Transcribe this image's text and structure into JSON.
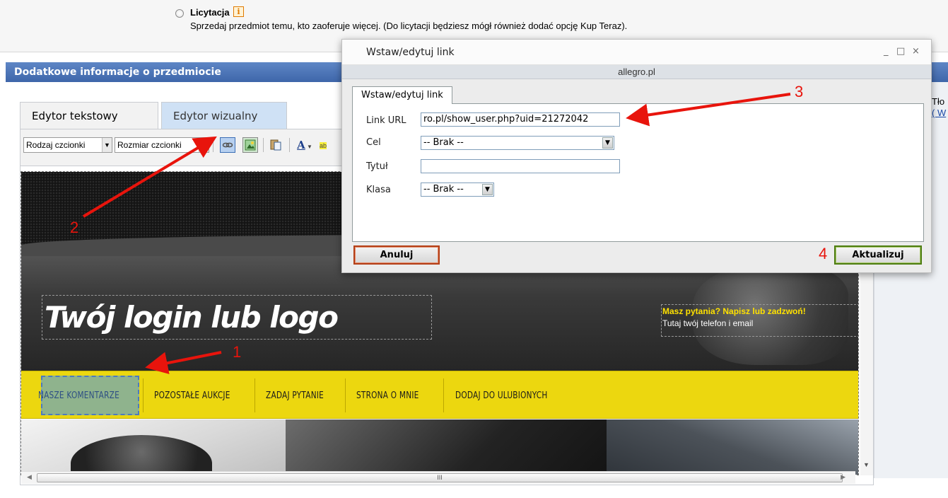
{
  "auction": {
    "title": "Licytacja",
    "info_icon_glyph": "i",
    "description": "Sprzedaj przedmiot temu, kto zaoferuje więcej. (Do licytacji będziesz mógł również dodać opcję Kup Teraz)."
  },
  "section": {
    "title": "Dodatkowe informacje o przedmiocie"
  },
  "right_panel": {
    "text": "Tło",
    "link": "( W"
  },
  "editor": {
    "tabs": [
      {
        "label": "Edytor tekstowy",
        "active": true
      },
      {
        "label": "Edytor wizualny",
        "active": false
      }
    ],
    "toolbar": {
      "font_family_select": "Rodzaj czcionki",
      "font_size_select": "Rozmiar czcionki",
      "icons": [
        "link-icon",
        "image-icon",
        "paste-icon",
        "font-color-icon",
        "highlight-icon"
      ]
    },
    "content": {
      "logo_text": "Twój login lub logo",
      "contact_question": "Masz pytania? Napisz lub zadzwoń!",
      "contact_text": "Tutaj twój telefon i email",
      "nav_items": [
        "NASZE KOMENTARZE",
        "POZOSTAŁE AUKCJE",
        "ZADAJ PYTANIE",
        "STRONA O MNIE",
        "DODAJ DO ULUBIONYCH"
      ]
    },
    "scrollbar_thumb_label": "III"
  },
  "dialog": {
    "title": "Wstaw/edytuj link",
    "domain": "allegro.pl",
    "tab": "Wstaw/edytuj link",
    "fields": {
      "url_label": "Link URL",
      "url_value": "ro.pl/show_user.php?uid=21272042",
      "target_label": "Cel",
      "target_value": "-- Brak --",
      "title_label": "Tytuł",
      "title_value": "",
      "class_label": "Klasa",
      "class_value": "-- Brak --"
    },
    "cancel_label": "Anuluj",
    "update_label": "Aktualizuj",
    "window_controls": [
      "minimize-icon",
      "maximize-icon",
      "close-icon"
    ]
  },
  "annotations": [
    "1",
    "2",
    "3",
    "4"
  ],
  "colors": {
    "annotation": "#e8140c",
    "section_bar": "#4a72b4",
    "nav_bar": "#ecd70f",
    "contact_question": "#ffe100"
  }
}
